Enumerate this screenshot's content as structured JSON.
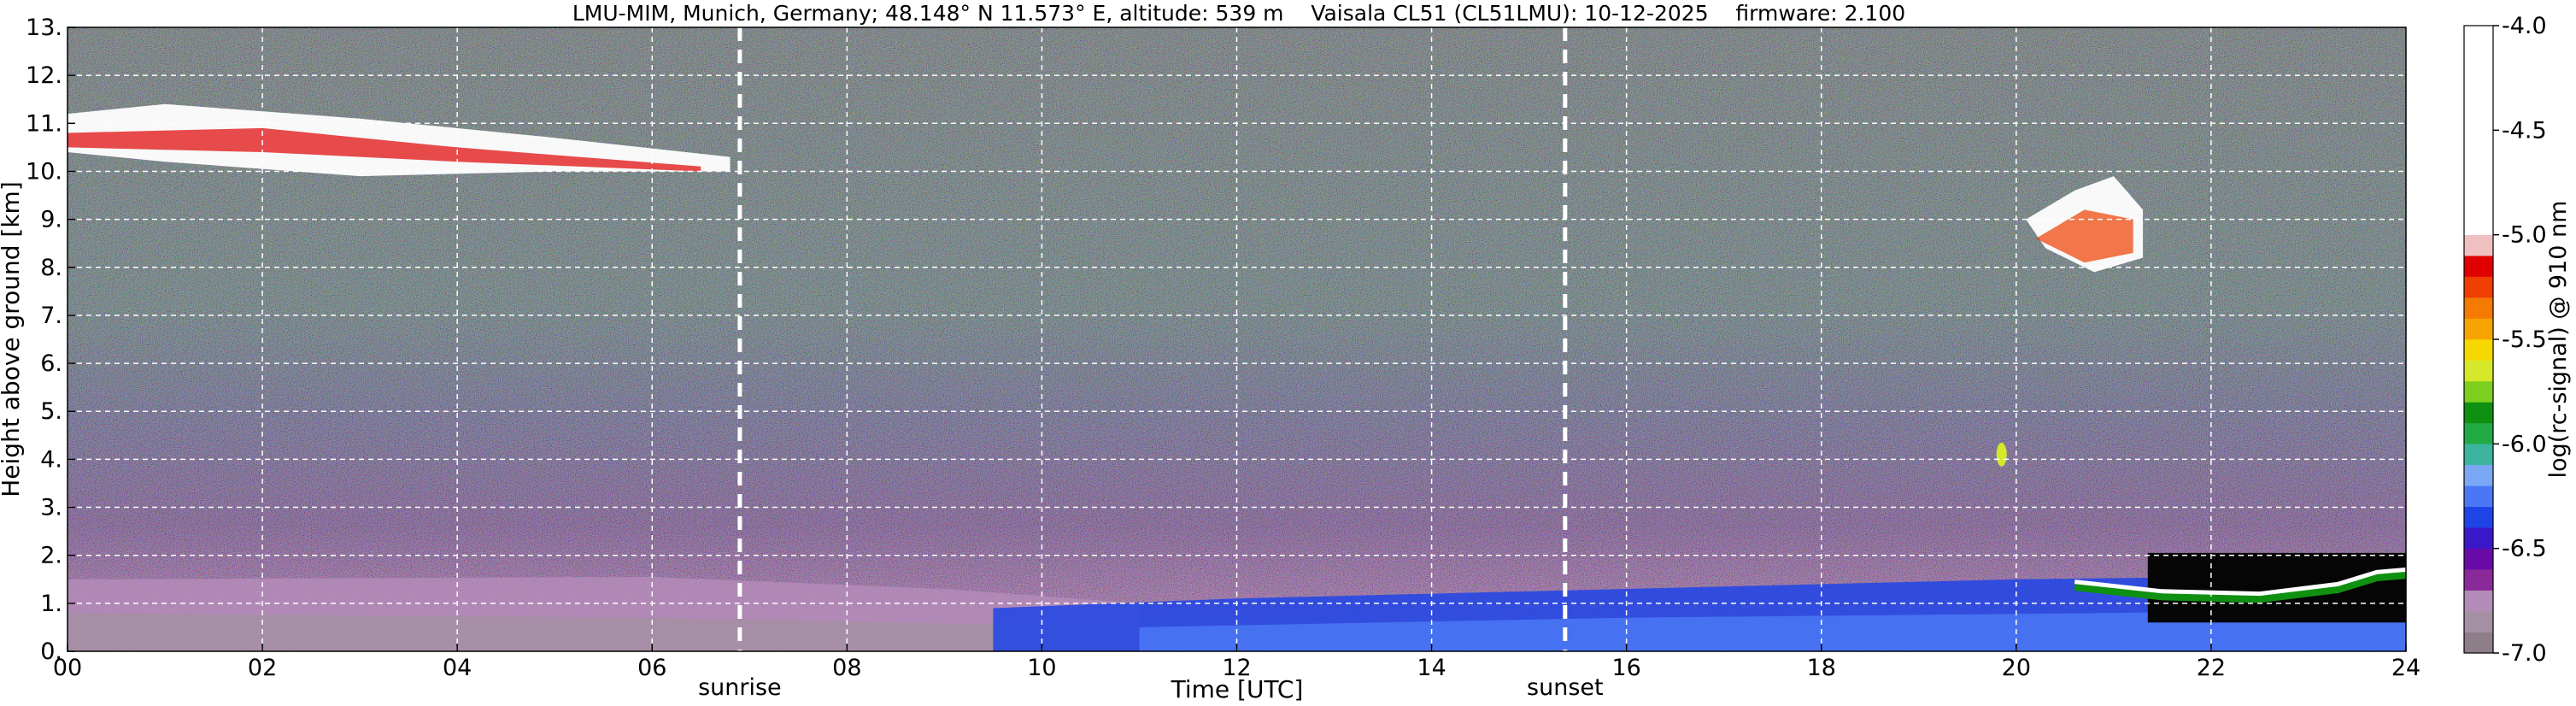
{
  "chart_data": {
    "type": "heatmap",
    "title": "LMU-MIM, Munich, Germany; 48.148° N 11.573° E, altitude: 539 m    Vaisala CL51 (CL51LMU): 10-12-2025    firmware: 2.100",
    "xlabel": "Time [UTC]",
    "ylabel": "Height above ground [km]",
    "xlim": [
      0,
      24
    ],
    "ylim": [
      0,
      13
    ],
    "x_ticks": [
      0,
      2,
      4,
      6,
      8,
      10,
      12,
      14,
      16,
      18,
      20,
      22,
      24
    ],
    "x_tick_labels": [
      "00",
      "02",
      "04",
      "06",
      "08",
      "10",
      "12",
      "14",
      "16",
      "18",
      "20",
      "22",
      "24"
    ],
    "y_ticks": [
      0,
      1,
      2,
      3,
      4,
      5,
      6,
      7,
      8,
      9,
      10,
      11,
      12,
      13
    ],
    "y_tick_labels": [
      "0.",
      "1.",
      "2.",
      "3.",
      "4.",
      "5.",
      "6.",
      "7.",
      "8.",
      "9.",
      "10.",
      "11.",
      "12.",
      "13."
    ],
    "grid": true,
    "markers": [
      {
        "label": "sunrise",
        "x": 6.9
      },
      {
        "label": "sunset",
        "x": 15.37
      }
    ],
    "colorbar": {
      "label": "log(rc-signal) @ 910 nm",
      "range": [
        -7.0,
        -4.0
      ],
      "ticks": [
        -4.0,
        -4.5,
        -5.0,
        -5.5,
        -6.0,
        -6.5,
        -7.0
      ],
      "tick_labels": [
        "-4.0",
        "-4.5",
        "-5.0",
        "-5.5",
        "-6.0",
        "-6.5",
        "-7.0"
      ],
      "bins": [
        {
          "from": -7.0,
          "to": -6.9,
          "color": "#8e7e8a"
        },
        {
          "from": -6.9,
          "to": -6.8,
          "color": "#a58fa3"
        },
        {
          "from": -6.8,
          "to": -6.7,
          "color": "#b48bb8"
        },
        {
          "from": -6.7,
          "to": -6.6,
          "color": "#8a2a9a"
        },
        {
          "from": -6.6,
          "to": -6.5,
          "color": "#6a0aa8"
        },
        {
          "from": -6.5,
          "to": -6.4,
          "color": "#3a18c8"
        },
        {
          "from": -6.4,
          "to": -6.3,
          "color": "#1e44e8"
        },
        {
          "from": -6.3,
          "to": -6.2,
          "color": "#4a78f4"
        },
        {
          "from": -6.2,
          "to": -6.1,
          "color": "#7aa8f4"
        },
        {
          "from": -6.1,
          "to": -6.0,
          "color": "#3cb4a0"
        },
        {
          "from": -6.0,
          "to": -5.9,
          "color": "#22aa44"
        },
        {
          "from": -5.9,
          "to": -5.8,
          "color": "#109010"
        },
        {
          "from": -5.8,
          "to": -5.7,
          "color": "#7ed020"
        },
        {
          "from": -5.7,
          "to": -5.6,
          "color": "#d6e82a"
        },
        {
          "from": -5.6,
          "to": -5.5,
          "color": "#f6d800"
        },
        {
          "from": -5.5,
          "to": -5.4,
          "color": "#f8a400"
        },
        {
          "from": -5.4,
          "to": -5.3,
          "color": "#f47a00"
        },
        {
          "from": -5.3,
          "to": -5.2,
          "color": "#ee3e00"
        },
        {
          "from": -5.2,
          "to": -5.1,
          "color": "#e00000"
        },
        {
          "from": -5.1,
          "to": -5.0,
          "color": "#f0c0c0"
        },
        {
          "from": -5.0,
          "to": -4.0,
          "color": "#ffffff"
        }
      ]
    }
  }
}
